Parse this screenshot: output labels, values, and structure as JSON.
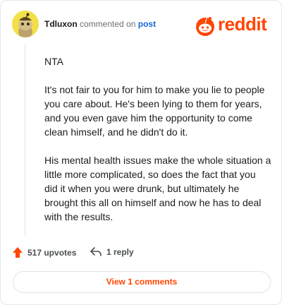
{
  "comment": {
    "author": "Tdluxon",
    "action_text": "commented on",
    "post_link": "post",
    "paragraphs": [
      "NTA",
      "It's not fair to you for him to make you lie to people you care about. He's been lying to them for years, and you even gave him the opportunity to come clean himself, and he didn't do it.",
      "His mental health issues make the whole situation a little more complicated, so does the fact that you did it when you were drunk, but ultimately he brought this all on himself and now he has to deal with the results."
    ],
    "upvotes_label": "517 upvotes",
    "replies_label": "1 reply",
    "view_comments_label": "View 1 comments"
  },
  "brand": {
    "logo_text": "reddit",
    "accent_color": "#ff4500",
    "link_color": "#1468d9"
  },
  "icons": {
    "upvote": "upvote-arrow-icon",
    "reply": "reply-arrow-icon",
    "logo": "reddit-alien-icon",
    "avatar": "snoo-avatar-icon"
  }
}
